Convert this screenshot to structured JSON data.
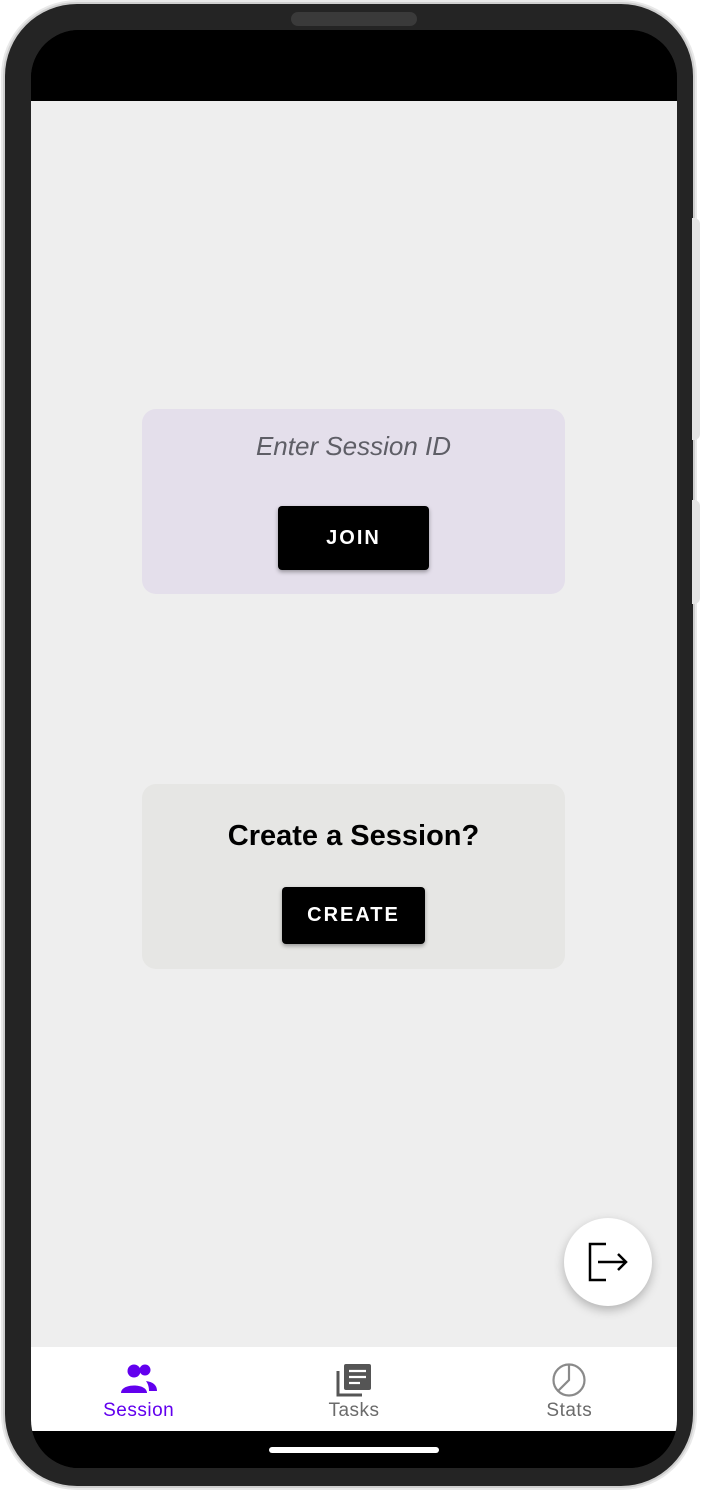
{
  "join_card": {
    "session_placeholder": "Enter Session ID",
    "session_value": "",
    "join_label": "JOIN"
  },
  "create_card": {
    "title": "Create a Session?",
    "create_label": "CREATE"
  },
  "fab": {
    "icon": "logout-icon"
  },
  "bottom_nav": {
    "items": [
      {
        "label": "Session",
        "icon": "people-icon",
        "active": true
      },
      {
        "label": "Tasks",
        "icon": "library-books-icon",
        "active": false
      },
      {
        "label": "Stats",
        "icon": "pie-chart-icon",
        "active": false
      }
    ]
  },
  "colors": {
    "accent": "#6200ee",
    "inactive": "#6b6b6b",
    "background": "#eeeeee",
    "join_card_bg": "#e4dfeb",
    "create_card_bg": "#e6e6e4",
    "button_bg": "#000000"
  }
}
